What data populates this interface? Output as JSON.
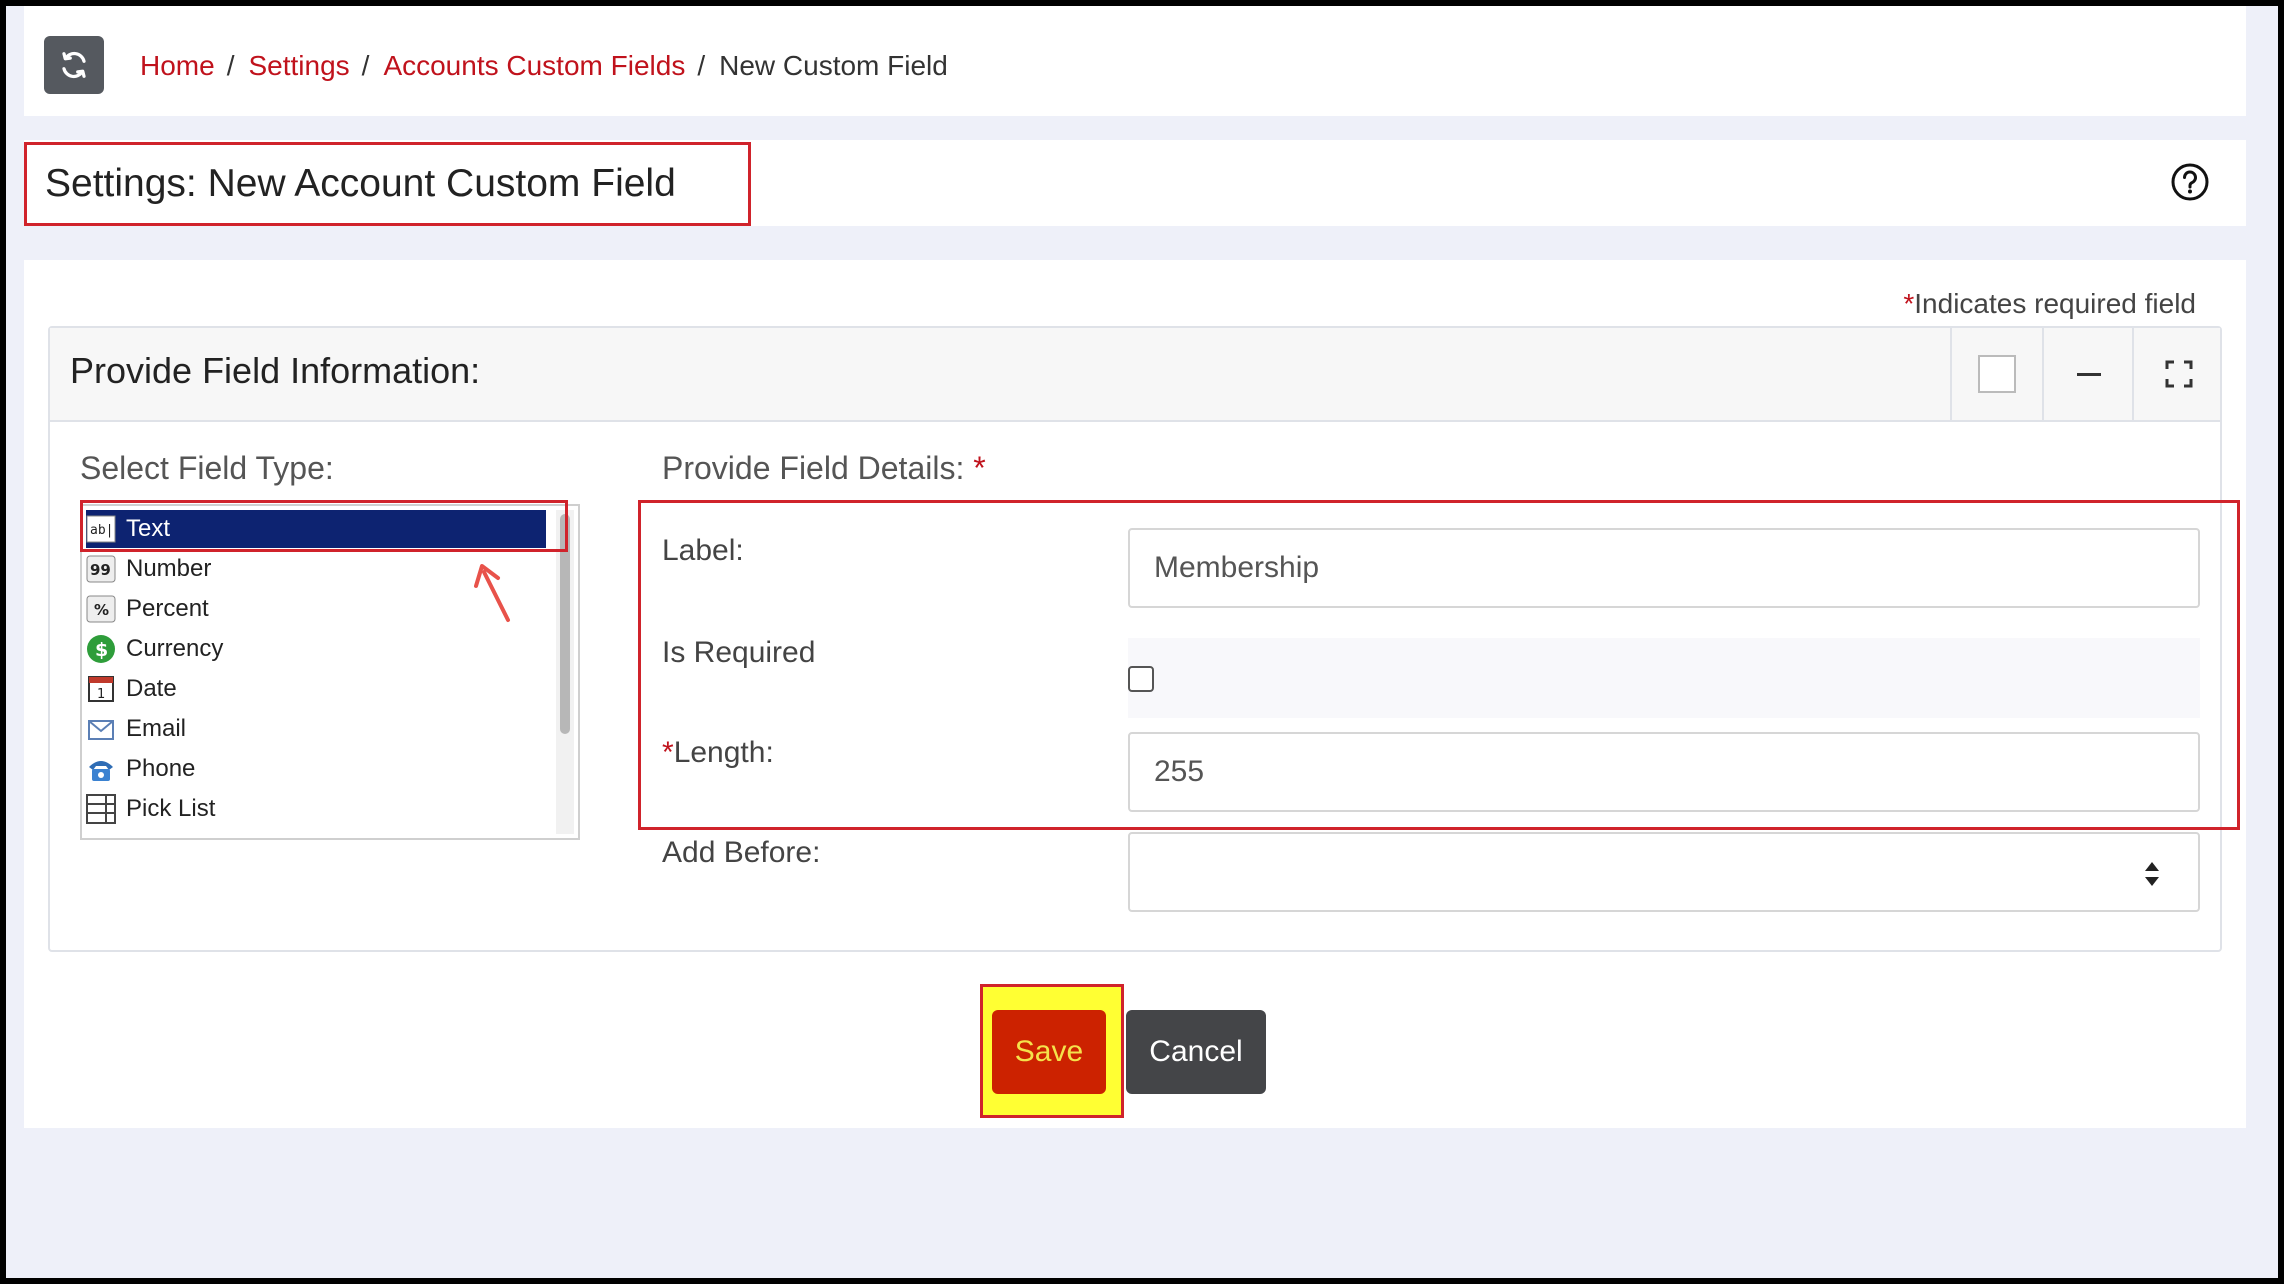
{
  "breadcrumb": {
    "items": [
      {
        "label": "Home"
      },
      {
        "label": "Settings"
      },
      {
        "label": "Accounts Custom Fields"
      }
    ],
    "separator": "/",
    "current": "New Custom Field"
  },
  "page": {
    "title": "Settings: New Account Custom Field"
  },
  "form": {
    "required_star": "*",
    "required_note": "Indicates required field",
    "panel_title": "Provide Field Information:",
    "field_type_label": "Select Field Type:",
    "field_types": [
      {
        "label": "Text",
        "icon": "text-field-icon",
        "selected": true
      },
      {
        "label": "Number",
        "icon": "number-icon",
        "selected": false
      },
      {
        "label": "Percent",
        "icon": "percent-icon",
        "selected": false
      },
      {
        "label": "Currency",
        "icon": "currency-icon",
        "selected": false
      },
      {
        "label": "Date",
        "icon": "calendar-icon",
        "selected": false
      },
      {
        "label": "Email",
        "icon": "envelope-icon",
        "selected": false
      },
      {
        "label": "Phone",
        "icon": "phone-icon",
        "selected": false
      },
      {
        "label": "Pick List",
        "icon": "pick-list-icon",
        "selected": false
      }
    ],
    "details_label": "Provide Field Details:",
    "label_field": {
      "label": "Label:",
      "value": "Membership"
    },
    "is_required": {
      "label": "Is Required",
      "checked": false
    },
    "length_field": {
      "label": "Length:",
      "value": "255"
    },
    "add_before": {
      "label": "Add Before:",
      "value": ""
    }
  },
  "actions": {
    "save_label": "Save",
    "cancel_label": "Cancel"
  },
  "colors": {
    "accent_red": "#c0121c",
    "selected_item_bg": "#0d2371",
    "save_bg": "#cc2200",
    "highlight_yellow": "#ffff33"
  }
}
